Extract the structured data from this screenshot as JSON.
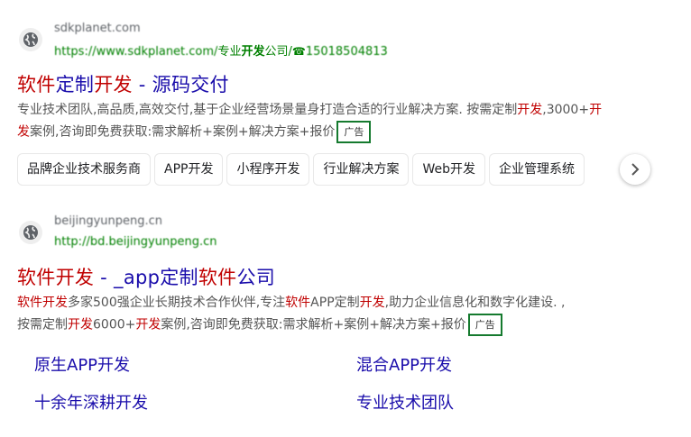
{
  "ad1": {
    "site_name": "sdkplanet.com",
    "url_prefix": "https://www.sdkplanet.com/",
    "url_tail_a": "专业",
    "url_tail_b": "开发",
    "url_tail_c": "公司/",
    "phone": "15018504813",
    "title_a": "软件",
    "title_b": "定制",
    "title_c": "开发",
    "title_d": " - 源码交付",
    "desc_a": "专业技术团队,高品质,高效交付,基于企业经营场景量身打造合适的行业解决方案. 按需定制",
    "desc_b": "开发",
    "desc_c": ",3000+",
    "desc_d": "开发",
    "desc_e": "案例,咨询即免费获取:需求解析+案例+解决方案+报价",
    "ad_label": "广告",
    "chips": [
      "品牌企业技术服务商",
      "APP开发",
      "小程序开发",
      "行业解决方案",
      "Web开发",
      "企业管理系统"
    ]
  },
  "ad2": {
    "site_name": "beijingyunpeng.cn",
    "url": "http://bd.beijingyunpeng.cn",
    "title_a": "软件开发",
    "title_b": " - _app定制",
    "title_c": "软件",
    "title_d": "公司",
    "desc_l1_a": "软件开发",
    "desc_l1_b": "多家500强企业长期技术合作伙伴,专注",
    "desc_l1_c": "软件",
    "desc_l1_d": "APP定制",
    "desc_l1_e": "开发",
    "desc_l1_f": ",助力企业信息化和数字化建设. ,",
    "desc_l2_a": "按需定制",
    "desc_l2_b": "开发",
    "desc_l2_c": "6000+",
    "desc_l2_d": "开发",
    "desc_l2_e": "案例,咨询即免费获取:需求解析+案例+解决方案+报价",
    "ad_label": "广告",
    "sitelinks": [
      "原生APP开发",
      "混合APP开发",
      "十余年深耕开发",
      "专业技术团队"
    ]
  },
  "colors": {
    "link": "#1a0dab",
    "highlight": "#c00000",
    "url_green": "#008000",
    "badge_border": "#157a2e"
  },
  "icons": {
    "site": "globe-icon",
    "phone": "phone-icon",
    "next": "chevron-right-icon"
  }
}
